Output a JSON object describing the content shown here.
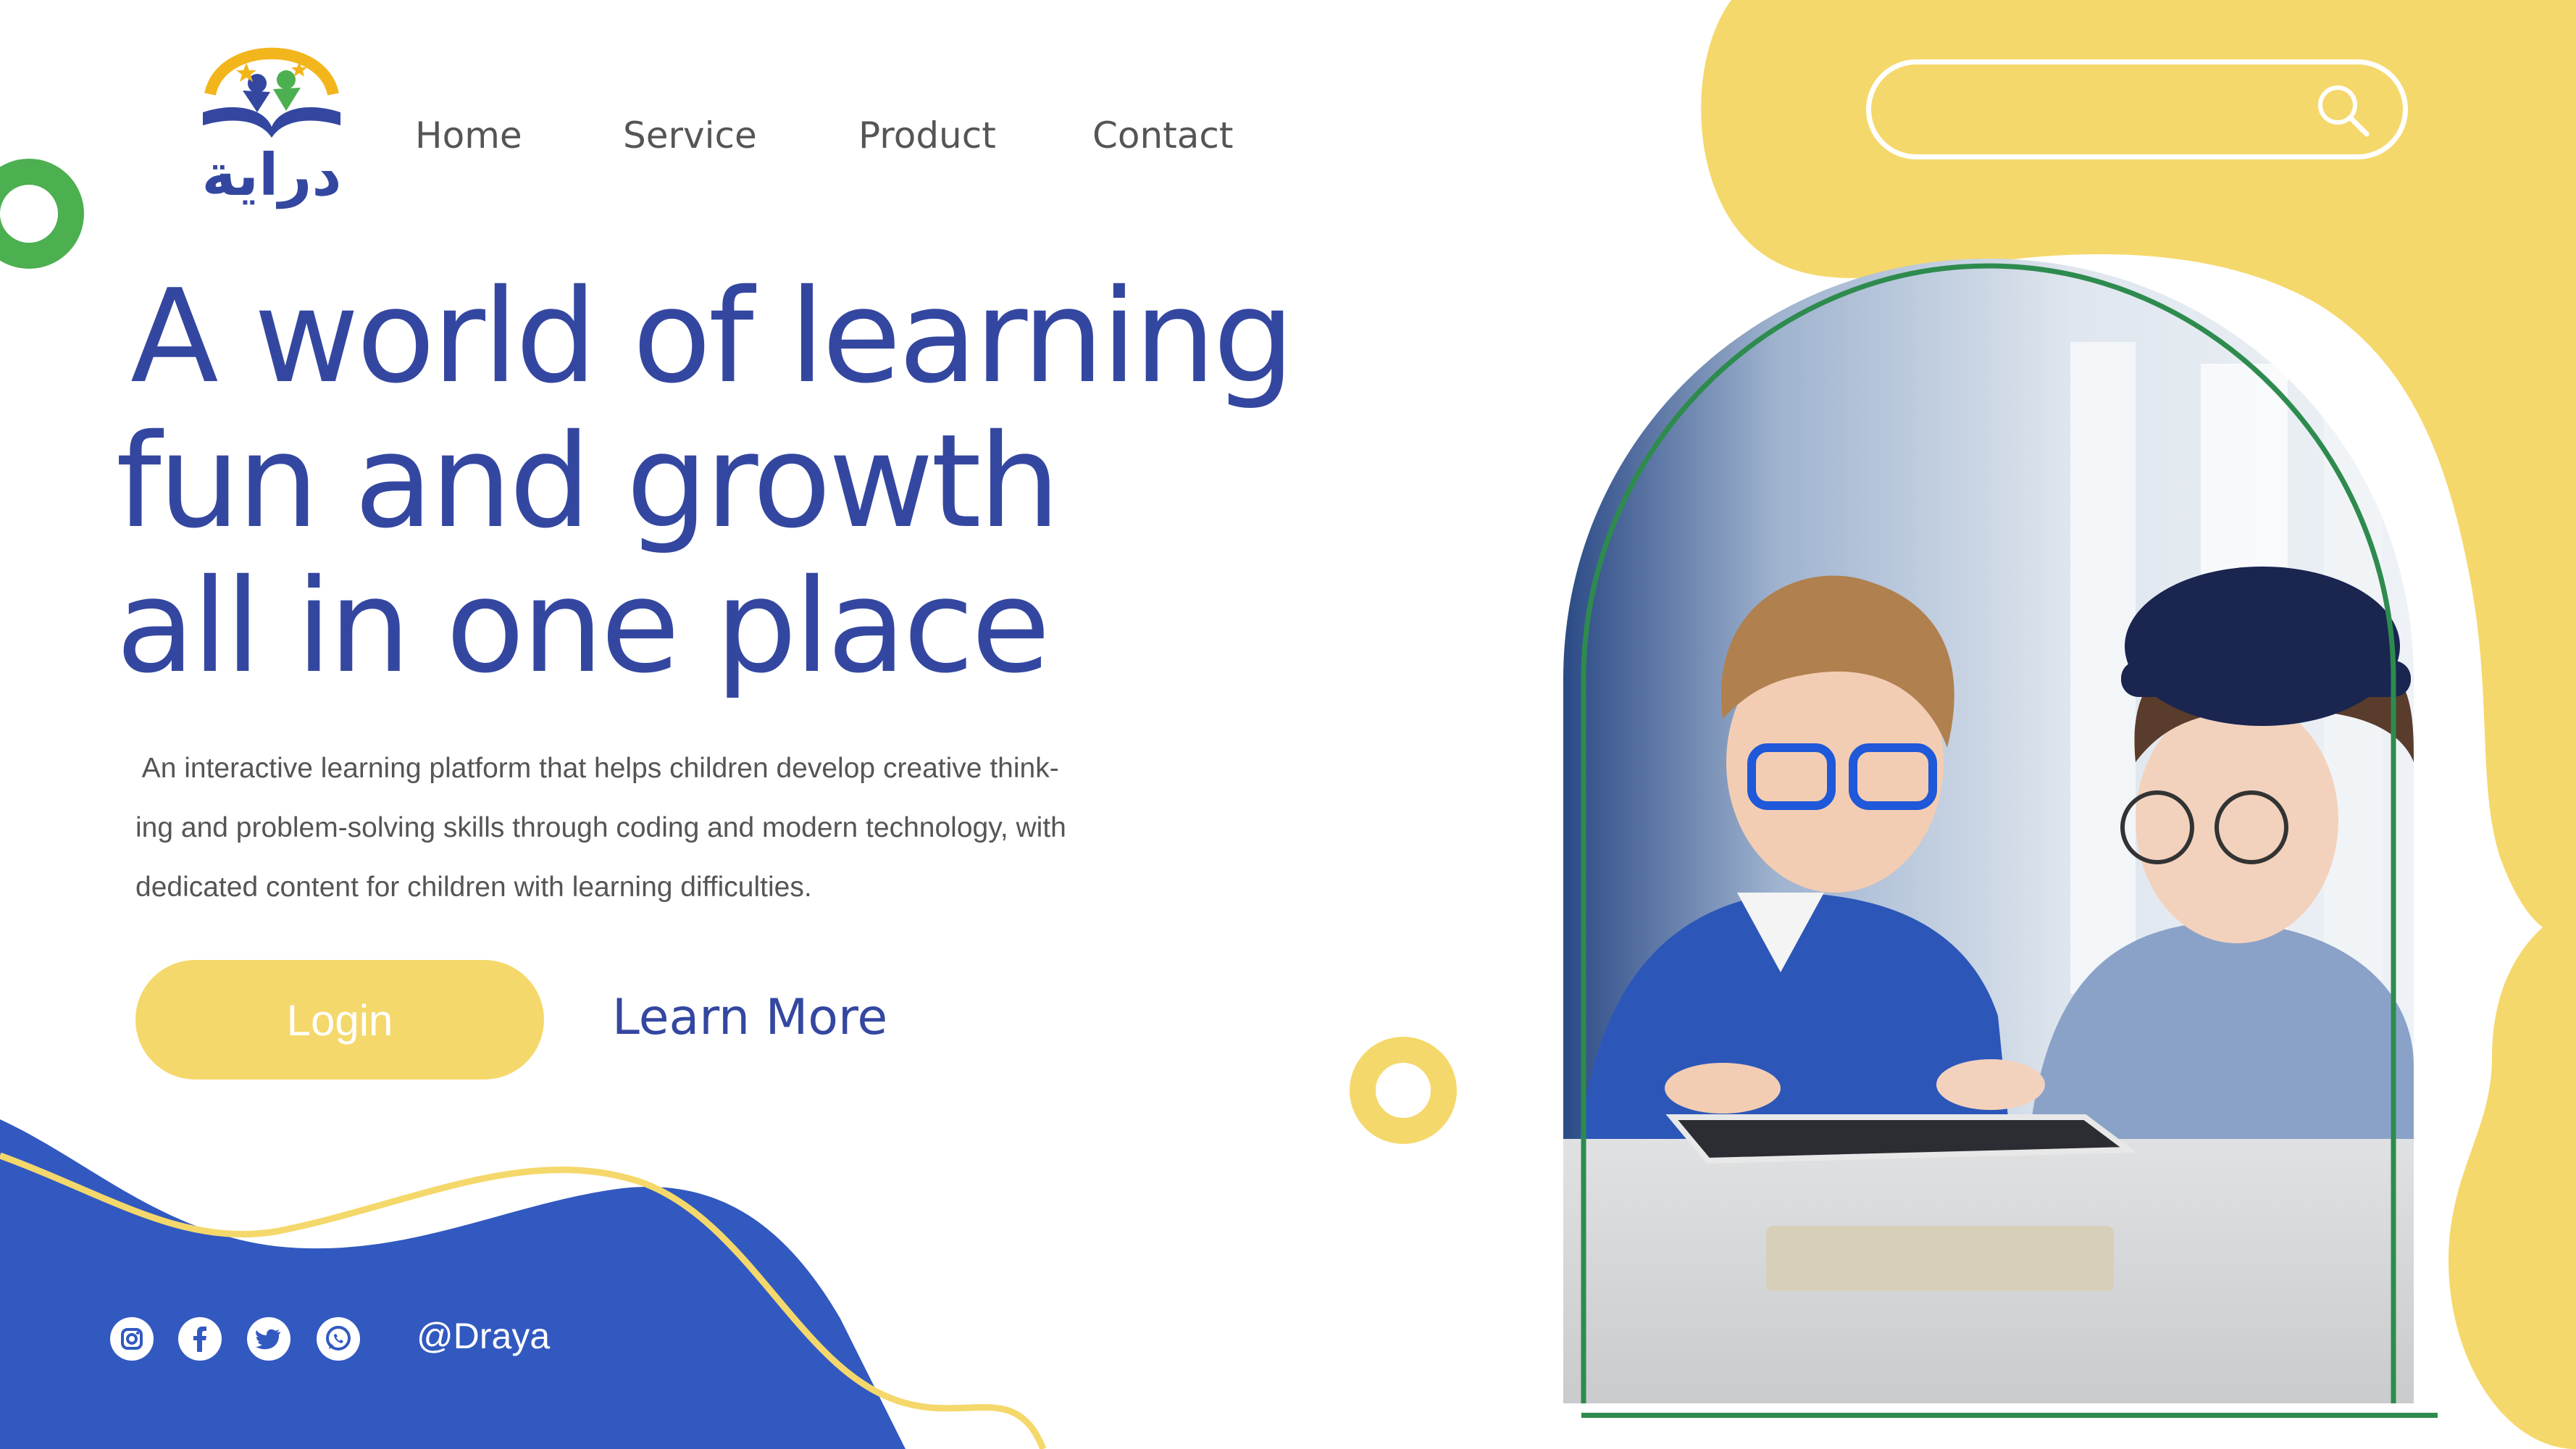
{
  "brand": {
    "logo_text": "دراية",
    "colors": {
      "primary_blue": "#3447a0",
      "wave_blue": "#3259c0",
      "yellow": "#f5d86b",
      "green": "#4caf50",
      "frame_green": "#2e8b4e"
    }
  },
  "nav": {
    "items": [
      {
        "label": "Home"
      },
      {
        "label": "Service"
      },
      {
        "label": "Product"
      },
      {
        "label": "Contact"
      }
    ]
  },
  "search": {
    "placeholder": "",
    "icon": "search-icon"
  },
  "hero": {
    "title_lines": [
      "A world of learning",
      "fun and growth",
      "all in one place"
    ],
    "description_lines": [
      " An interactive learning platform that helps children develop creative think-",
      "ing and problem-solving skills through coding and modern technology, with",
      "dedicated content for children with learning difficulties."
    ]
  },
  "buttons": {
    "login": "Login",
    "learn_more": "Learn More"
  },
  "social": {
    "icons": [
      "instagram-icon",
      "facebook-icon",
      "twitter-icon",
      "whatsapp-icon"
    ],
    "handle": "@Draya"
  },
  "photo": {
    "subject": "two children with glasses looking at a tablet"
  }
}
